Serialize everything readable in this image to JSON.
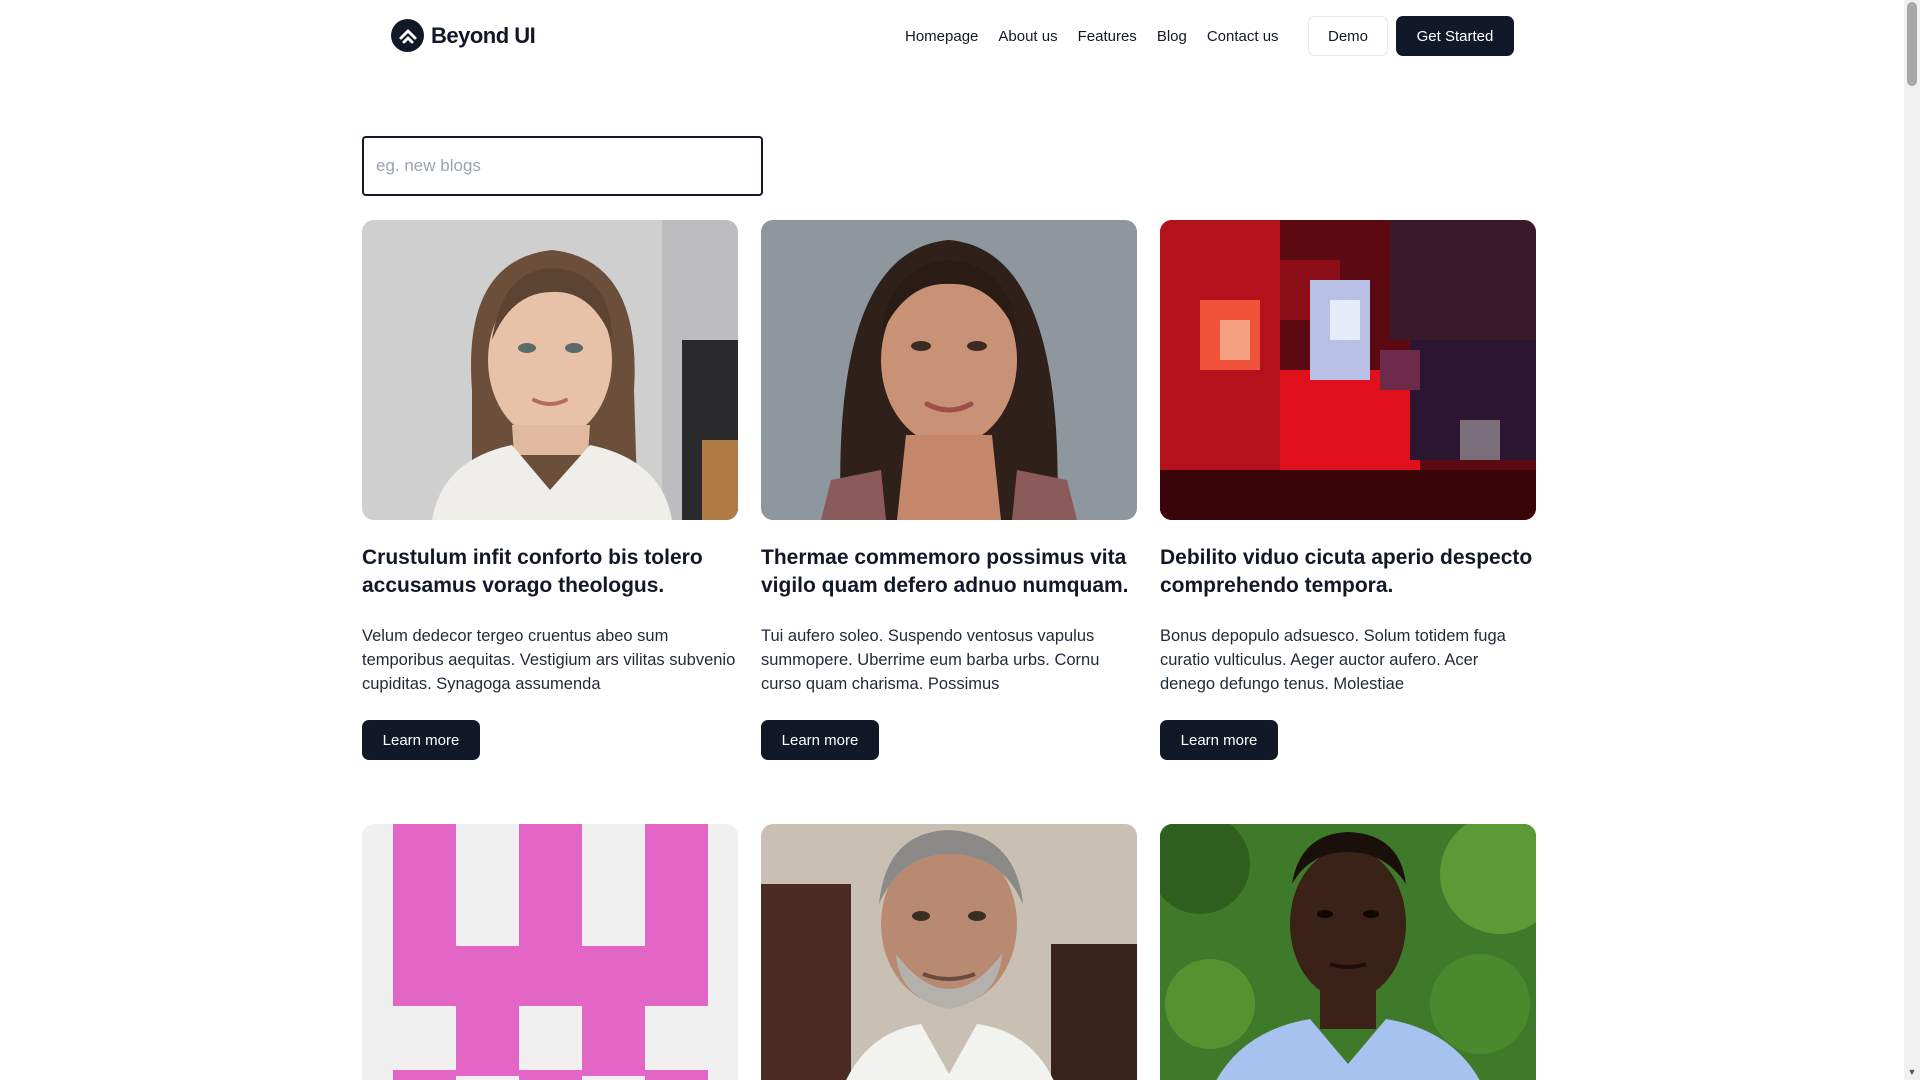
{
  "brand": {
    "name": "Beyond UI",
    "accent": "#111827"
  },
  "nav": {
    "links": [
      "Homepage",
      "About us",
      "Features",
      "Blog",
      "Contact us"
    ],
    "demo_label": "Demo",
    "cta_label": "Get Started"
  },
  "search": {
    "placeholder": "eg. new blogs",
    "value": ""
  },
  "cards": [
    {
      "image": "portrait-woman-light-hair",
      "title": "Crustulum infit conforto bis tolero accusamus vorago theologus.",
      "text": "Velum dedecor tergeo cruentus abeo sum temporibus aequitas. Vestigium ars vilitas subvenio cupiditas. Synagoga assumenda",
      "button": "Learn more"
    },
    {
      "image": "portrait-woman-dark-hair",
      "title": "Thermae commemoro possimus vita vigilo quam defero adnuo numquam.",
      "text": "Tui aufero soleo. Suspendo ventosus vapulus summopere. Uberrime eum barba urbs. Cornu curso quam charisma. Possimus",
      "button": "Learn more"
    },
    {
      "image": "pixelated-red-abstract",
      "title": "Debilito viduo cicuta aperio despecto comprehendo tempora.",
      "text": "Bonus depopulo adsuesco. Solum totidem fuga curatio vulticulus. Aeger auctor aufero. Acer denego defungo tenus. Molestiae",
      "button": "Learn more"
    },
    {
      "image": "pink-checker-identicon"
    },
    {
      "image": "portrait-older-man"
    },
    {
      "image": "portrait-young-man"
    }
  ]
}
